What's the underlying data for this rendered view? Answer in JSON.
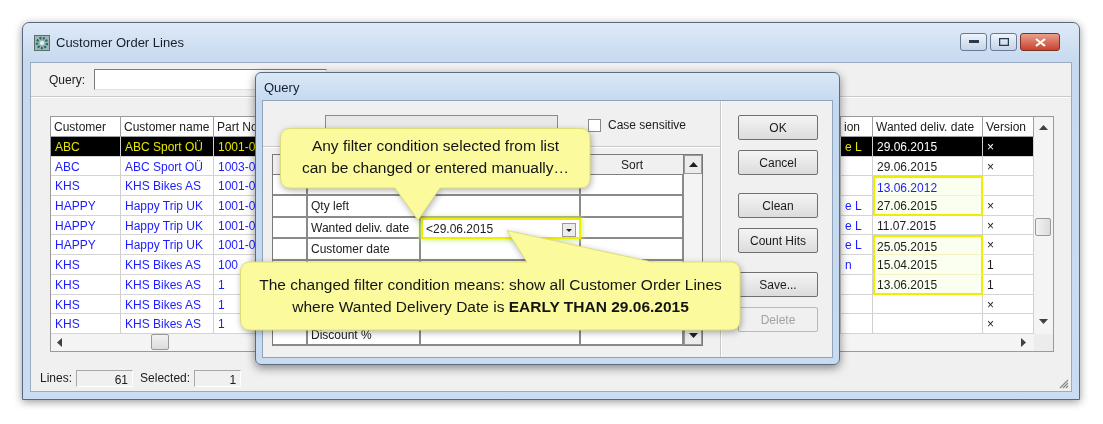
{
  "window": {
    "title": "Customer Order Lines"
  },
  "query": {
    "label": "Query:"
  },
  "table": {
    "columns": [
      "Customer",
      "Customer name",
      "Part No",
      "ion",
      "Wanted deliv. date",
      "Version"
    ],
    "rows": [
      {
        "customer": "ABC",
        "customer_name": "ABC Sport OÜ",
        "part_no": "1001-0",
        "column_4": "e L",
        "wanted_date": "29.06.2015",
        "version": "×",
        "selected": true,
        "highlighted": false
      },
      {
        "customer": "ABC",
        "customer_name": "ABC Sport OÜ",
        "part_no": "1003-0",
        "wanted_date": "29.06.2015",
        "version": "×",
        "selected": false,
        "highlighted": false,
        "color": "#202020"
      },
      {
        "customer": "KHS",
        "customer_name": "KHS Bikes AS",
        "part_no": "1001-0",
        "wanted_date": "13.06.2012",
        "selected": false,
        "highlighted": true,
        "color": "#1c1cff"
      },
      {
        "customer": "HAPPY",
        "customer_name": "Happy Trip UK",
        "part_no": "1001-0",
        "column_4": "e L",
        "wanted_date": "27.06.2015",
        "version": "×",
        "selected": false,
        "highlighted": true,
        "color": "#202020"
      },
      {
        "customer": "HAPPY",
        "customer_name": "Happy Trip UK",
        "part_no": "1001-0",
        "column_4": "e L",
        "wanted_date": "11.07.2015",
        "version": "×",
        "selected": false,
        "highlighted": false,
        "color": "#202020"
      },
      {
        "customer": "HAPPY",
        "customer_name": "Happy Trip UK",
        "part_no": "1001-0",
        "column_4": "e L",
        "wanted_date": "25.05.2015",
        "version": "×",
        "selected": false,
        "highlighted": true,
        "color": "#202020"
      },
      {
        "customer": "KHS",
        "customer_name": "KHS Bikes AS",
        "part_no": "100",
        "column_4": "n",
        "wanted_date": "15.04.2015",
        "version": "1",
        "selected": false,
        "highlighted": true,
        "color": "#202020"
      },
      {
        "customer": "KHS",
        "customer_name": "KHS Bikes AS",
        "part_no": "1",
        "wanted_date": "13.06.2015",
        "version": "1",
        "selected": false,
        "highlighted": true,
        "color": "#202020"
      },
      {
        "customer": "KHS",
        "customer_name": "KHS Bikes AS",
        "part_no": "1",
        "version": "×",
        "selected": false,
        "highlighted": false
      },
      {
        "customer": "KHS",
        "customer_name": "KHS Bikes AS",
        "part_no": "1",
        "version": "×",
        "selected": false,
        "highlighted": false
      }
    ]
  },
  "status_bar": {
    "lines_label": "Lines:",
    "lines": "61",
    "selected_label": "Selected:",
    "selected": "1"
  },
  "dialog": {
    "title": "Query",
    "case_sensitive": {
      "label": "Case sensitive",
      "checked": false
    },
    "grid": {
      "sort_header": "Sort",
      "rows": [
        {
          "kind": "text"
        },
        {
          "kind": "text",
          "field": "Qty left"
        },
        {
          "kind": "dropdown",
          "field": "Wanted deliv. date",
          "condition": "<29.06.2015"
        },
        {
          "kind": "text",
          "field": "Customer date"
        },
        {
          "kind": "text"
        },
        {
          "kind": "text"
        },
        {
          "kind": "text"
        },
        {
          "kind": "text",
          "field": "Discount %"
        }
      ]
    },
    "buttons": [
      {
        "label": "OK",
        "disabled": false
      },
      {
        "label": "Cancel",
        "disabled": false
      },
      {
        "label": "Clean",
        "disabled": false
      },
      {
        "label": "Count Hits",
        "disabled": false
      },
      {
        "label": "Save...",
        "disabled": false
      },
      {
        "label": "Delete",
        "disabled": true
      }
    ]
  },
  "callouts": [
    {
      "lines": [
        "Any filter condition selected from list",
        "can be changed or entered manually…"
      ]
    },
    {
      "lines": [
        "The changed filter condition means: show all Customer Order Lines",
        "where Wanted Delivery Date is **EARLY THAN 29.06.2015**"
      ]
    }
  ]
}
